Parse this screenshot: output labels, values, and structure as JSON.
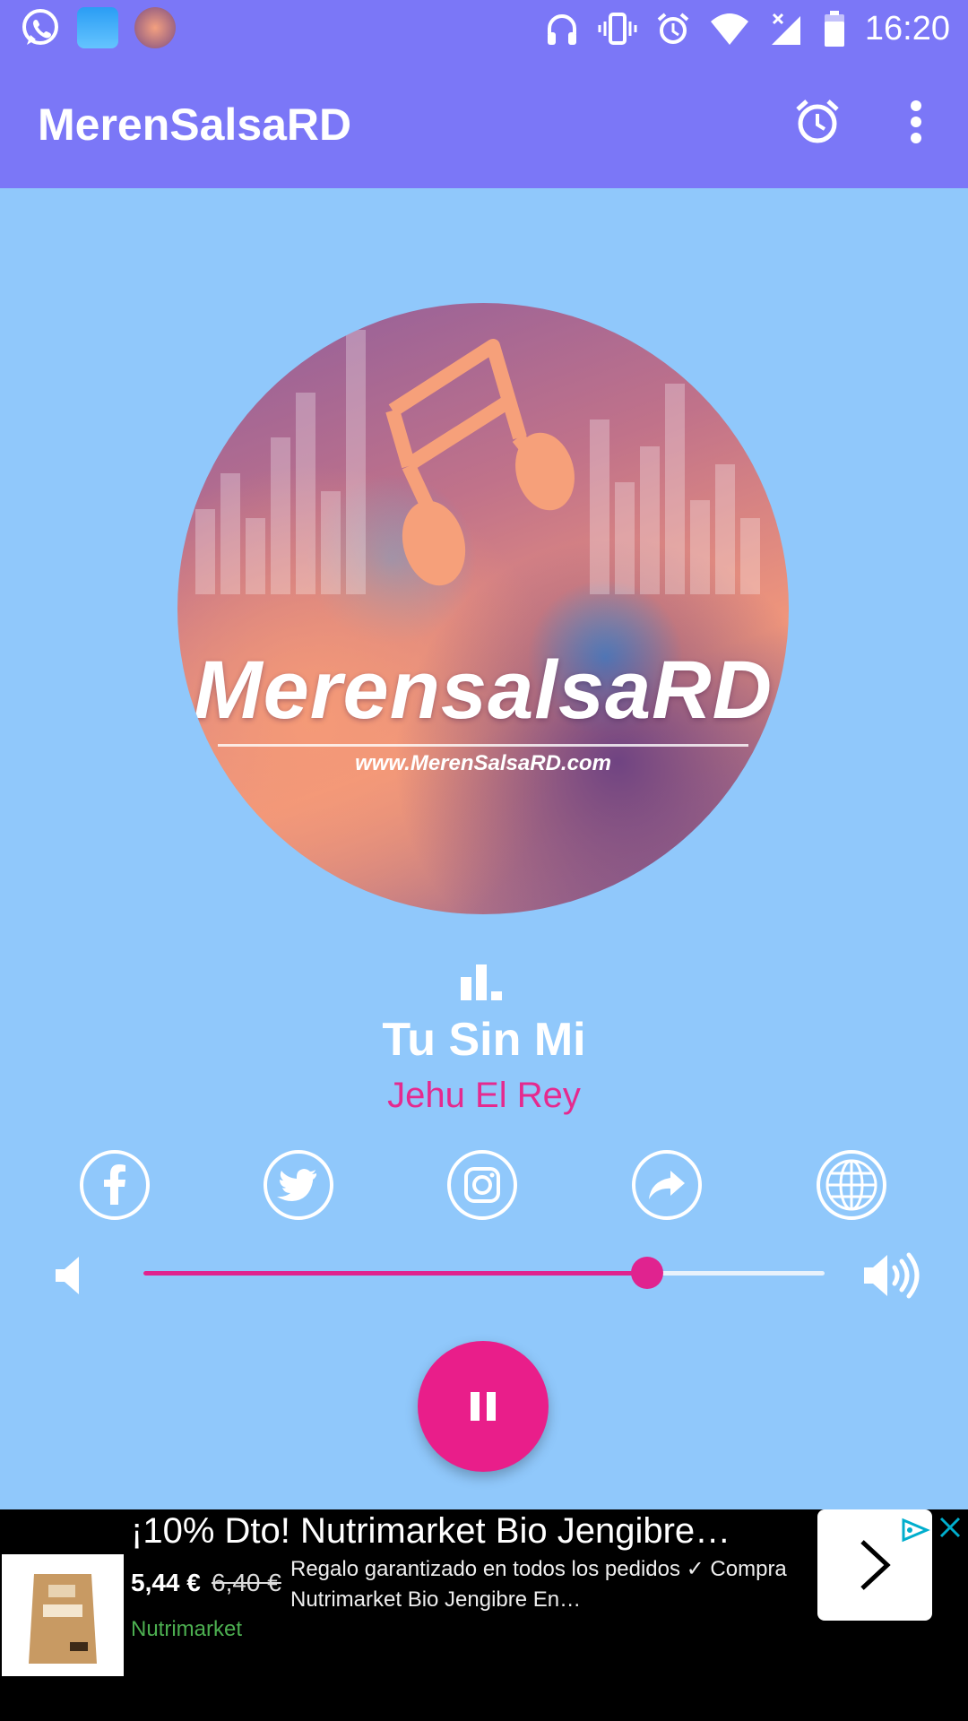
{
  "status_bar": {
    "time": "16:20",
    "left_icons": [
      "whatsapp-icon",
      "weather-app-icon",
      "merensalsard-app-icon"
    ],
    "right_icons": [
      "headphones-icon",
      "vibrate-icon",
      "alarm-icon",
      "wifi-icon",
      "signal-icon",
      "battery-icon"
    ]
  },
  "app_bar": {
    "title": "MerenSalsaRD",
    "actions": [
      "alarm-clock-icon",
      "more-vert-icon"
    ]
  },
  "artwork": {
    "logo_text": "MerensalsaRD",
    "url_text": "www.MerenSalsaRD.com"
  },
  "now_playing": {
    "title": "Tu Sin Mi",
    "artist": "Jehu El Rey",
    "status_icon": "equalizer-icon"
  },
  "social": [
    "facebook-icon",
    "twitter-icon",
    "instagram-icon",
    "share-icon",
    "website-globe-icon"
  ],
  "volume": {
    "level": 0.74,
    "low_icon": "volume-low-icon",
    "high_icon": "volume-high-icon"
  },
  "player": {
    "state": "playing",
    "button_icon": "pause-icon"
  },
  "ad": {
    "title": "¡10% Dto! Nutrimarket Bio Jengibre…",
    "price": "5,44 €",
    "old_price": "6,40 €",
    "description": "Regalo garantizado en todos los pedidos ✓ Compra Nutrimarket Bio Jengibre En…",
    "brand": "Nutrimarket"
  },
  "colors": {
    "app_bar": "#7b77f7",
    "background": "#90c8fb",
    "accent": "#e91e8a",
    "artist_text": "#e52a8f"
  }
}
